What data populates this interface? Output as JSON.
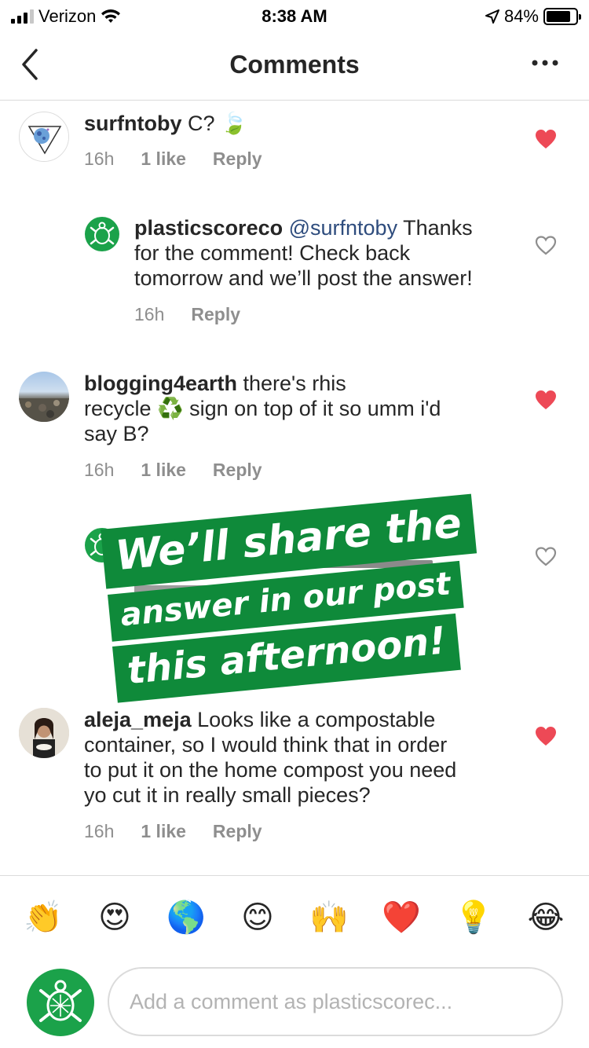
{
  "status_bar": {
    "carrier": "Verizon",
    "time": "8:38 AM",
    "battery": "84%",
    "battery_level": 0.84
  },
  "header": {
    "title": "Comments",
    "more_label": "•••"
  },
  "comments": [
    {
      "username": "surfntoby",
      "text": "C? 🍃",
      "time": "16h",
      "likes": "1 like",
      "reply": "Reply",
      "liked": true
    },
    {
      "username": "plasticscoreco",
      "mention": "@surfntoby",
      "text_line1": "Thanks",
      "text_line2": "for the comment! Check back",
      "text_line3": "tomorrow and we’ll post the answer!",
      "time": "16h",
      "reply": "Reply",
      "liked": false
    },
    {
      "username": "blogging4earth",
      "text_line1": "there's rhis",
      "text_line2": "recycle ♻️ sign on top of it so umm i'd",
      "text_line3": "say B?",
      "time": "16h",
      "likes": "1 like",
      "reply": "Reply",
      "liked": true
    },
    {
      "username": "aleja_meja",
      "text_line1": "Looks like a compostable",
      "text_line2": "container, so I would think that in order",
      "text_line3": "to put it on the home compost you need",
      "text_line4": "yo cut it in really small pieces?",
      "time": "16h",
      "likes": "1 like",
      "reply": "Reply",
      "liked": true
    }
  ],
  "overlay": {
    "line1": "We’ll share the",
    "line2": "answer in our post",
    "line3": "this afternoon!"
  },
  "quick_emojis": [
    "👏",
    "😍",
    "🌎",
    "😊",
    "🙌",
    "❤️",
    "💡",
    "😂"
  ],
  "composer": {
    "placeholder": "Add a comment as plasticscorec..."
  },
  "colors": {
    "heart_red": "#ed4956",
    "brand_green": "#1ba24a",
    "banner_green": "#0f8a3a",
    "muted": "#8e8e8e"
  }
}
